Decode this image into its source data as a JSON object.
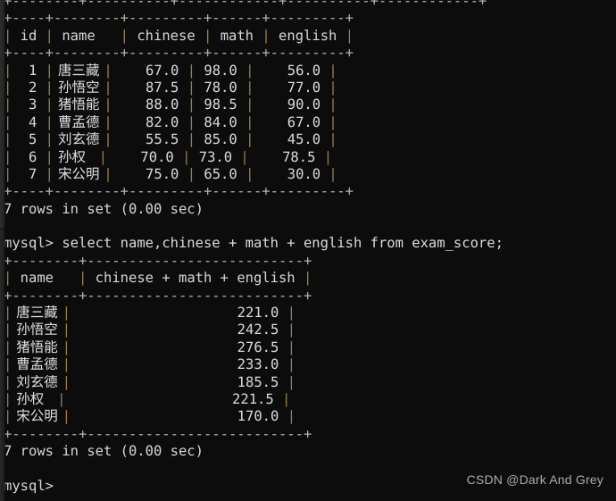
{
  "terminal": {
    "app": "mysql-client-terminal",
    "background_color": "#0c0c0c",
    "text_color": "#cfcfcf",
    "border_color": "#b9b2a4",
    "prompt": "mysql>",
    "top_partial_line": "+--------+----------+------------+----------+------------+"
  },
  "query1": {
    "status": "7 rows in set (0.00 sec)",
    "table": {
      "top_rule": "+------+-----------+---------+--------+---------+",
      "header_sep": "+------+-----------+---------+--------+---------+",
      "bottom_rule": "+------+-----------+---------+--------+---------+",
      "columns": [
        "id",
        "name",
        "chinese",
        "math",
        "english"
      ],
      "rows": [
        {
          "id": "1",
          "name": "唐三藏",
          "chinese": "67.0",
          "math": "98.0",
          "english": "56.0"
        },
        {
          "id": "2",
          "name": "孙悟空",
          "chinese": "87.5",
          "math": "78.0",
          "english": "77.0"
        },
        {
          "id": "3",
          "name": "猪悟能",
          "chinese": "88.0",
          "math": "98.5",
          "english": "90.0"
        },
        {
          "id": "4",
          "name": "曹孟德",
          "chinese": "82.0",
          "math": "84.0",
          "english": "67.0"
        },
        {
          "id": "5",
          "name": "刘玄德",
          "chinese": "55.5",
          "math": "85.0",
          "english": "45.0"
        },
        {
          "id": "6",
          "name": "孙权",
          "chinese": "70.0",
          "math": "73.0",
          "english": "78.5"
        },
        {
          "id": "7",
          "name": "宋公明",
          "chinese": "75.0",
          "math": "65.0",
          "english": "30.0"
        }
      ]
    }
  },
  "query2": {
    "prompt": "mysql>",
    "command": "select name,chinese + math + english from exam_score;",
    "status": "7 rows in set (0.00 sec)",
    "table": {
      "top_rule": "+--------+--------------------------+",
      "header_sep": "+--------+--------------------------+",
      "bottom_rule": "+--------+--------------------------+",
      "columns": [
        "name",
        "chinese + math + english"
      ],
      "rows": [
        {
          "name": "唐三藏",
          "total": "221.0"
        },
        {
          "name": "孙悟空",
          "total": "242.5"
        },
        {
          "name": "猪悟能",
          "total": "276.5"
        },
        {
          "name": "曹孟德",
          "total": "233.0"
        },
        {
          "name": "刘玄德",
          "total": "185.5"
        },
        {
          "name": "孙权",
          "total": "221.5"
        },
        {
          "name": "宋公明",
          "total": "170.0"
        }
      ]
    }
  },
  "final_prompt": "mysql>",
  "watermark": "CSDN @Dark And Grey"
}
